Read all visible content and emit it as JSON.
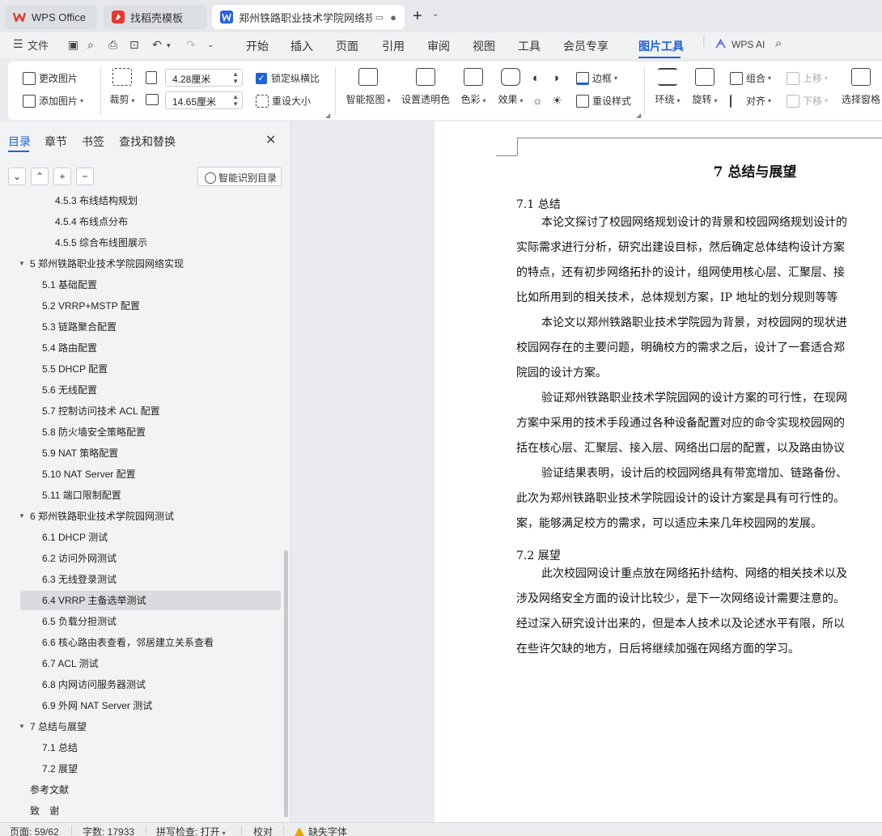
{
  "tabs": [
    {
      "label": "WPS Office"
    },
    {
      "label": "找稻壳模板"
    },
    {
      "label": "郑州铁路职业技术学院网络规"
    }
  ],
  "menu": {
    "file": "文件",
    "items": [
      "开始",
      "插入",
      "页面",
      "引用",
      "审阅",
      "视图",
      "工具",
      "会员专享",
      "图片工具"
    ],
    "active": "图片工具",
    "ai": "WPS AI"
  },
  "ribbon": {
    "change_picture": "更改图片",
    "add_picture": "添加图片",
    "crop": "裁剪",
    "width_value": "4.28厘米",
    "height_value": "14.65厘米",
    "lock_ratio": "锁定纵横比",
    "reset_size": "重设大小",
    "smart_cutout": "智能抠图",
    "set_transparent": "设置透明色",
    "color": "色彩",
    "effects": "效果",
    "border": "边框",
    "reset_style": "重设样式",
    "wrap": "环绕",
    "rotate": "旋转",
    "group": "组合",
    "align": "对齐",
    "move_up": "上移",
    "move_down": "下移",
    "selection_pane": "选择窗格"
  },
  "navpane": {
    "tabs": [
      "目录",
      "章节",
      "书签",
      "查找和替换"
    ],
    "smart_toc_button": "智能识别目录",
    "toc": [
      {
        "label": "4.5.3  布线结构规划",
        "level": 3
      },
      {
        "label": "4.5.4  布线点分布",
        "level": 3
      },
      {
        "label": "4.5.5  综合布线图展示",
        "level": 3
      },
      {
        "label": "5  郑州铁路职业技术学院园网络实现",
        "level": 1
      },
      {
        "label": "5.1 基础配置",
        "level": 2
      },
      {
        "label": "5.2 VRRP+MSTP 配置",
        "level": 2
      },
      {
        "label": "5.3 链路聚合配置",
        "level": 2
      },
      {
        "label": "5.4 路由配置",
        "level": 2
      },
      {
        "label": "5.5 DHCP 配置",
        "level": 2
      },
      {
        "label": "5.6 无线配置",
        "level": 2
      },
      {
        "label": "5.7 控制访问技术 ACL 配置",
        "level": 2
      },
      {
        "label": "5.8 防火墙安全策略配置",
        "level": 2
      },
      {
        "label": "5.9 NAT 策略配置",
        "level": 2
      },
      {
        "label": "5.10 NAT Server 配置",
        "level": 2
      },
      {
        "label": "5.11 端口限制配置",
        "level": 2
      },
      {
        "label": "6  郑州铁路职业技术学院园网测试",
        "level": 1
      },
      {
        "label": "6.1 DHCP 测试",
        "level": 2
      },
      {
        "label": "6.2 访问外网测试",
        "level": 2
      },
      {
        "label": "6.3 无线登录测试",
        "level": 2
      },
      {
        "label": "6.4 VRRP 主备选举测试",
        "level": 2
      },
      {
        "label": "6.5 负载分担测试",
        "level": 2
      },
      {
        "label": "6.6 核心路由表查看，邻居建立关系查看",
        "level": 2
      },
      {
        "label": "6.7 ACL 测试",
        "level": 2
      },
      {
        "label": "6.8 内网访问服务器测试",
        "level": 2
      },
      {
        "label": "6.9 外网 NAT Server 测试",
        "level": 2
      },
      {
        "label": "7  总结与展望",
        "level": 1
      },
      {
        "label": "7.1  总结",
        "level": 2
      },
      {
        "label": "7.2  展望",
        "level": 2
      },
      {
        "label": "参考文献",
        "level": 0
      },
      {
        "label": "致　谢",
        "level": 0
      }
    ],
    "selected_item": "6.4 VRRP 主备选举测试"
  },
  "document": {
    "chapter_title": "7  总结与展望",
    "sections": [
      {
        "heading": "7.1  总结",
        "lines": [
          {
            "text": "本论文探讨了校园网络规划设计的背景和校园网络规划设计的",
            "indent": true
          },
          {
            "text": "实际需求进行分析，研究出建设目标，然后确定总体结构设计方案",
            "indent": false
          },
          {
            "text": "的特点，还有初步网络拓扑的设计，组网使用核心层、汇聚层、接",
            "indent": false
          },
          {
            "text": "比如所用到的相关技术，总体规划方案，IP 地址的划分规则等等",
            "indent": false
          },
          {
            "text": "本论文以郑州铁路职业技术学院园为背景，对校园网的现状进",
            "indent": true
          },
          {
            "text": "校园网存在的主要问题，明确校方的需求之后，设计了一套适合郑",
            "indent": false
          },
          {
            "text": "院园的设计方案。",
            "indent": false
          },
          {
            "text": "验证郑州铁路职业技术学院园网的设计方案的可行性，在现网",
            "indent": true
          },
          {
            "text": "方案中采用的技术手段通过各种设备配置对应的命令实现校园网的",
            "indent": false
          },
          {
            "text": "括在核心层、汇聚层、接入层、网络出口层的配置，以及路由协议",
            "indent": false
          },
          {
            "text": "验证结果表明，设计后的校园网络具有带宽增加、链路备份、",
            "indent": true
          },
          {
            "text": "此次为郑州铁路职业技术学院园设计的设计方案是具有可行性的。",
            "indent": false
          },
          {
            "text": "案，能够满足校方的需求，可以适应未来几年校园网的发展。",
            "indent": false
          }
        ]
      },
      {
        "heading": "7.2  展望",
        "lines": [
          {
            "text": "此次校园网设计重点放在网络拓扑结构、网络的相关技术以及",
            "indent": true
          },
          {
            "text": "涉及网络安全方面的设计比较少，是下一次网络设计需要注意的。",
            "indent": false
          },
          {
            "text": "经过深入研究设计出来的，但是本人技术以及论述水平有限，所以",
            "indent": false
          },
          {
            "text": "在些许欠缺的地方，日后将继续加强在网络方面的学习。",
            "indent": false
          }
        ]
      }
    ]
  },
  "status": {
    "page": "页面: 59/62",
    "words": "字数: 17933",
    "spellcheck": "拼写检查: 打开",
    "proofread": "校对",
    "missing_font": "缺失字体"
  },
  "colors": {
    "accent": "#1f62d8",
    "wps_logo": "#e8382f",
    "docer_logo": "#e8382f",
    "writer_icon": "#2b5fe3",
    "ai_logo": "#5b5ef0",
    "warning": "#e5a400"
  }
}
